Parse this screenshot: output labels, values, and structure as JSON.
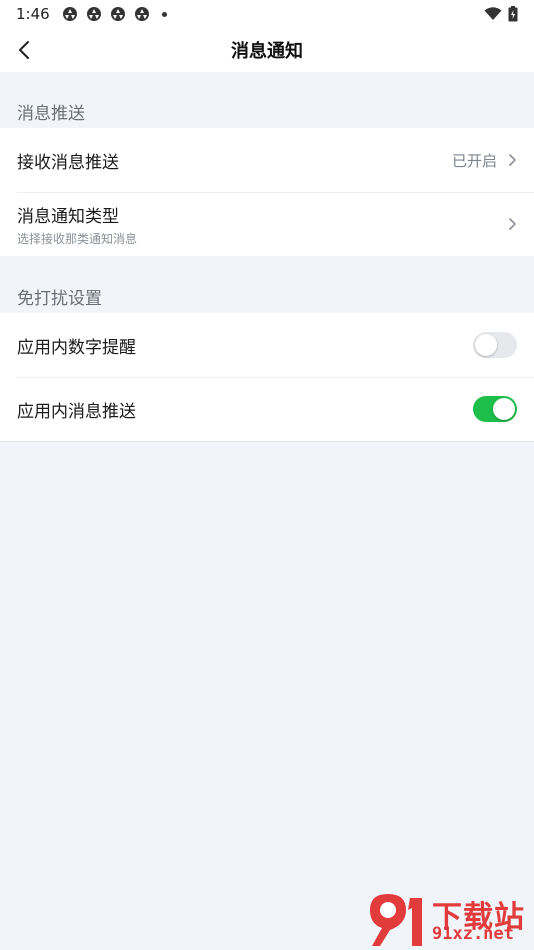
{
  "status_bar": {
    "time": "1:46",
    "notification_icons": [
      "app-icon",
      "app-icon",
      "app-icon",
      "app-icon"
    ],
    "icons_right": [
      "wifi-icon",
      "battery-icon"
    ]
  },
  "nav": {
    "title": "消息通知",
    "back_icon": "chevron-left-icon"
  },
  "sections": {
    "push": {
      "header": "消息推送",
      "rows": [
        {
          "label": "接收消息推送",
          "value": "已开启"
        },
        {
          "label": "消息通知类型",
          "subtitle": "选择接收那类通知消息"
        }
      ]
    },
    "dnd": {
      "header": "免打扰设置",
      "rows": [
        {
          "label": "应用内数字提醒",
          "toggle": false
        },
        {
          "label": "应用内消息推送",
          "toggle": true
        }
      ]
    }
  },
  "colors": {
    "background": "#f1f4f9",
    "toggle_on": "#1dbf4a",
    "toggle_off": "#e6e8ec"
  },
  "watermark": {
    "top": "下载站",
    "bottom": "91xz.net"
  }
}
